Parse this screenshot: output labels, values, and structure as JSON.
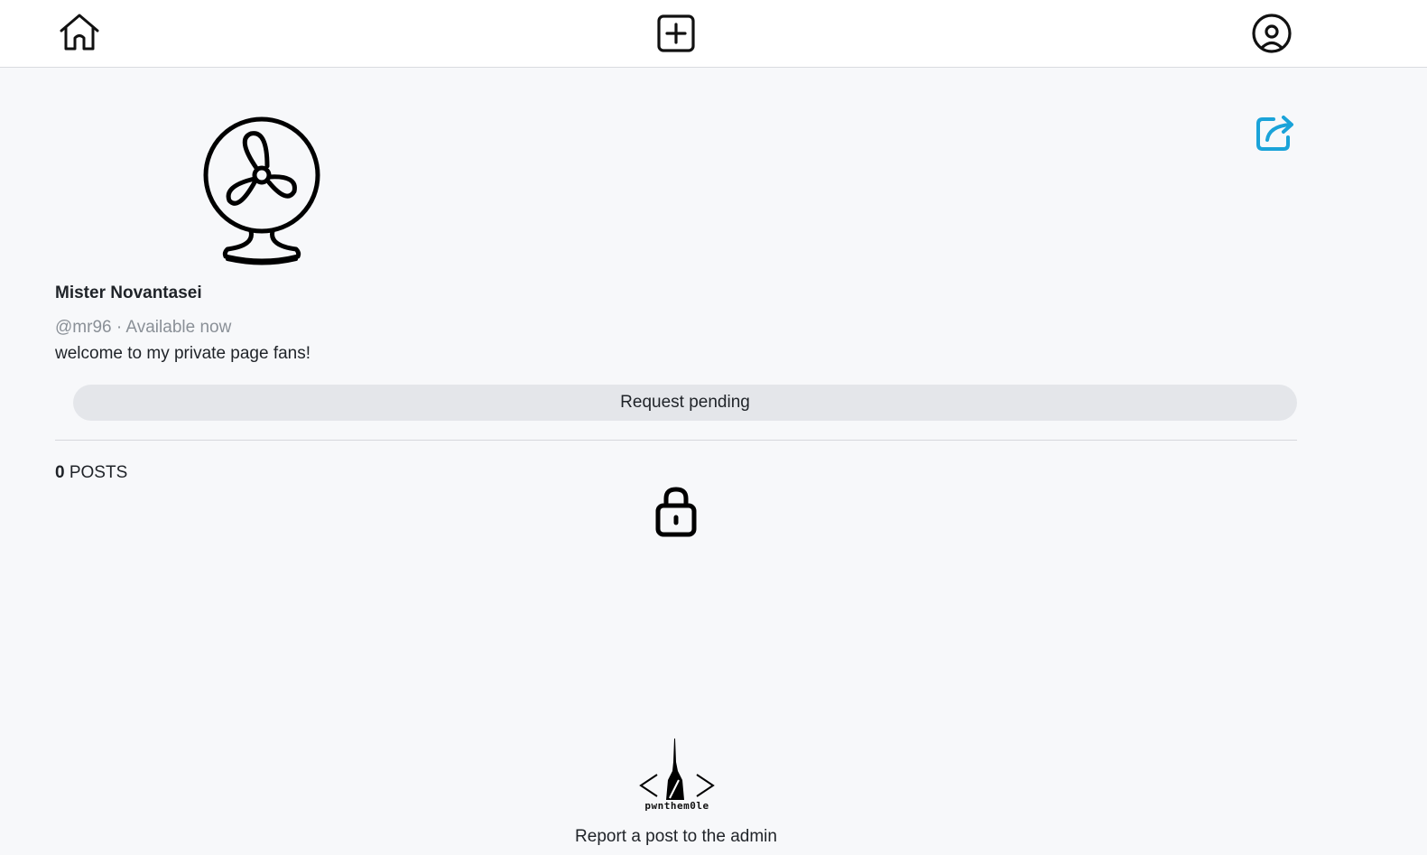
{
  "navbar": {
    "home_icon": "home-icon",
    "create_icon": "plus-square-icon",
    "profile_icon": "user-circle-icon"
  },
  "profile": {
    "display_name": "Mister Novantasei",
    "meta": "@mr96 · Available now",
    "bio": "welcome to my private page fans!",
    "avatar_icon": "fan-icon",
    "share_icon": "share-icon",
    "request_button_label": "Request pending"
  },
  "posts": {
    "count": "0",
    "label": "POSTS",
    "lock_icon": "lock-icon"
  },
  "footer": {
    "logo_text": "pwnthem0le",
    "report_link": "Report a post to the admin"
  },
  "colors": {
    "accent": "#1aa3d9",
    "background": "#f7f8fa",
    "button_bg": "#e4e6ea"
  }
}
